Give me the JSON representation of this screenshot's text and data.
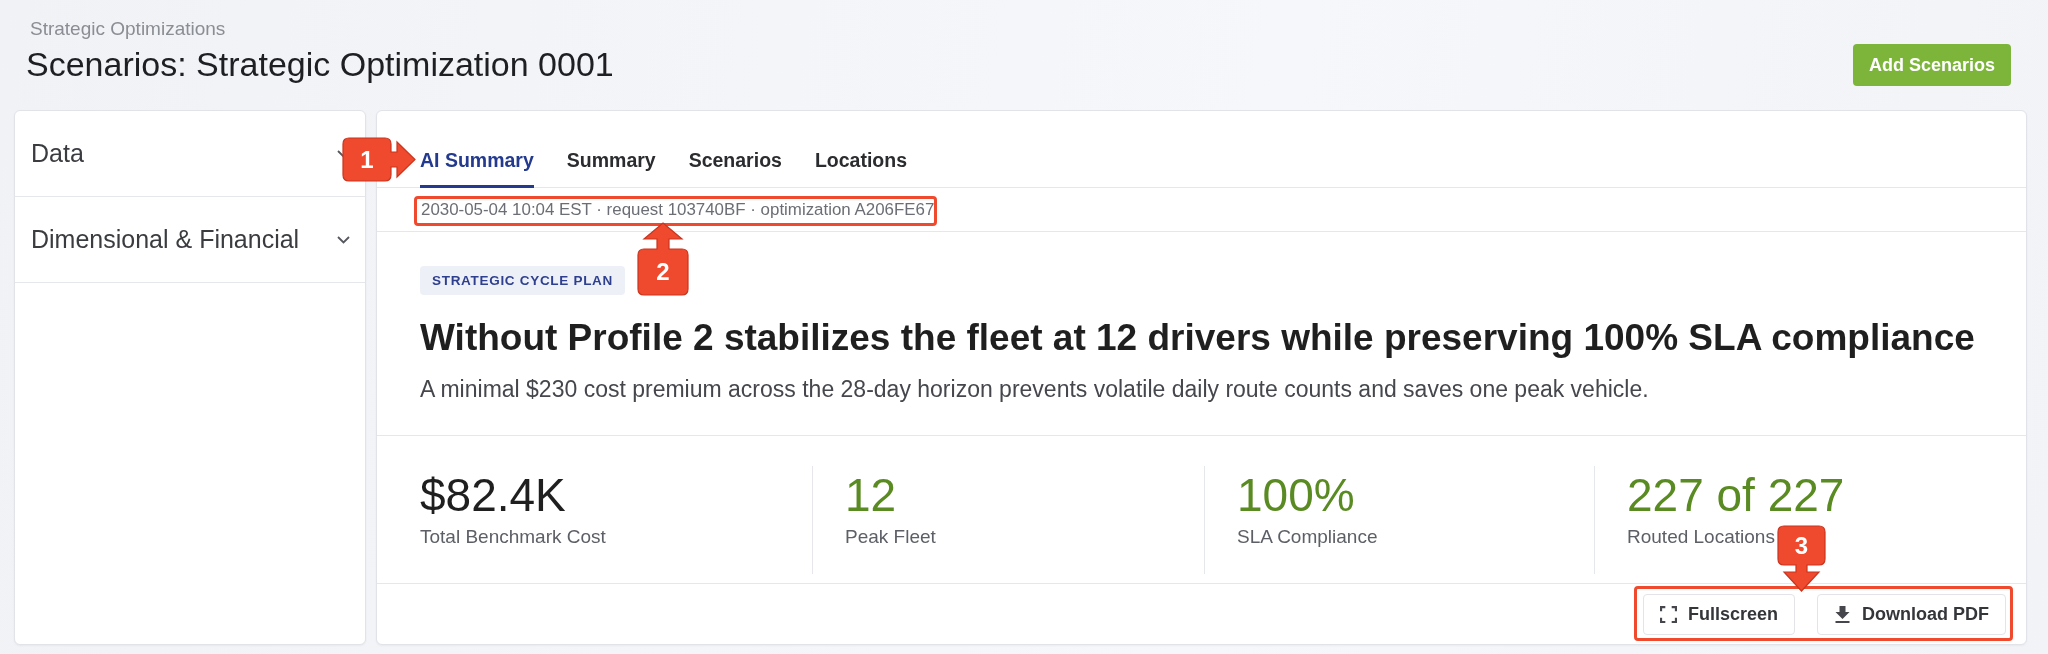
{
  "header": {
    "breadcrumb": "Strategic Optimizations",
    "title": "Scenarios: Strategic Optimization 0001",
    "primary_button": "Add Scenarios"
  },
  "sidebar": {
    "items": [
      {
        "label": "Data",
        "expanded": false
      },
      {
        "label": "Dimensional & Financial",
        "expanded": false
      }
    ]
  },
  "tabs": {
    "items": [
      {
        "label": "AI Summary",
        "selected": true
      },
      {
        "label": "Summary",
        "selected": false
      },
      {
        "label": "Scenarios",
        "selected": false
      },
      {
        "label": "Locations",
        "selected": false
      }
    ],
    "callout": {
      "number": "1",
      "kind": "right",
      "framed": false
    }
  },
  "meta": {
    "text": "2030-05-04 10:04 EST · request 103740BF · optimization A206FE67",
    "callout": {
      "number": "2",
      "kind": "up",
      "framed": true
    }
  },
  "summary": {
    "tag": "STRATEGIC CYCLE PLAN",
    "headline": "Without Profile 2 stabilizes the fleet at 12 drivers while preserving 100% SLA compliance",
    "description": "A minimal $230 cost premium across the 28-day horizon prevents volatile daily route counts and saves one peak vehicle."
  },
  "stats": [
    {
      "value": "$82.4K",
      "label": "Total Benchmark Cost",
      "color": "#1f1f1f"
    },
    {
      "value": "12",
      "label": "Peak Fleet",
      "color": "#5a8a22"
    },
    {
      "value": "100%",
      "label": "SLA Compliance",
      "color": "#5a8a22"
    },
    {
      "value": "227 of 227",
      "label": "Routed Locations",
      "color": "#5a8a22"
    }
  ],
  "actions": {
    "buttons": [
      {
        "label": "Fullscreen",
        "kind": "fullscreen"
      },
      {
        "label": "Download PDF",
        "kind": "download"
      }
    ],
    "callout": {
      "number": "3",
      "kind": "down",
      "framed": true
    }
  }
}
